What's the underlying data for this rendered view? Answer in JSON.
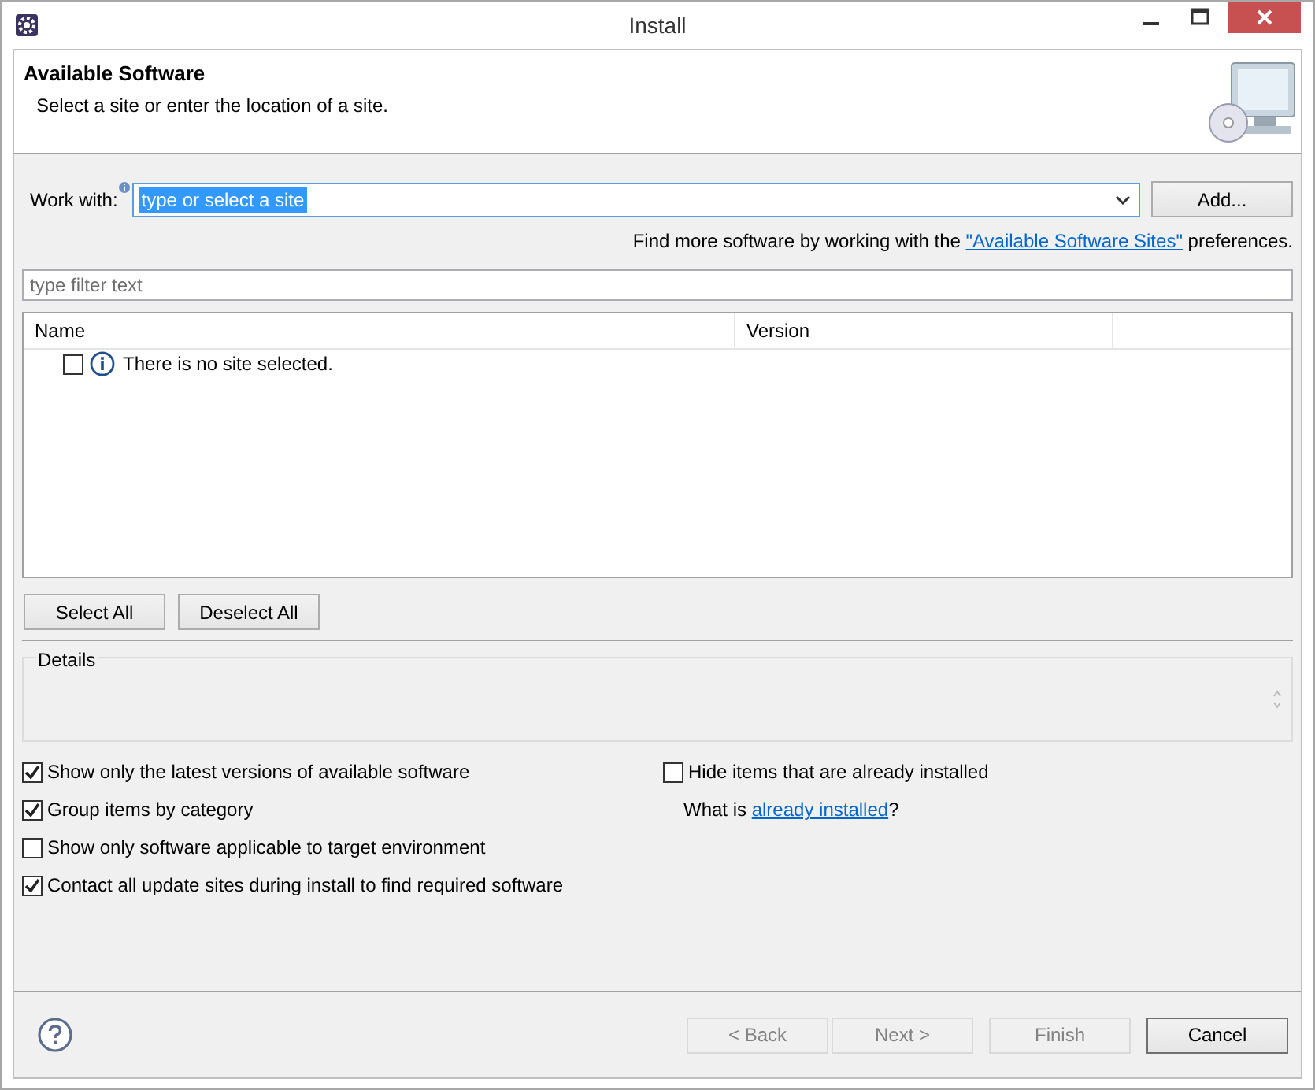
{
  "window": {
    "title": "Install"
  },
  "header": {
    "title": "Available Software",
    "description": "Select a site or enter the location of a site."
  },
  "work_with": {
    "label": "Work with:",
    "value": "type or select a site",
    "text_selected": true,
    "button": "Add..."
  },
  "find_more": {
    "before": "Find more software by working with the ",
    "link": "\"Available Software Sites\"",
    "after": " preferences."
  },
  "filter": {
    "placeholder": "type filter text"
  },
  "table": {
    "columns": [
      "Name",
      "Version"
    ],
    "rows": [
      {
        "checked": false,
        "text": "There is no site selected."
      }
    ]
  },
  "selection_buttons": [
    "Select All",
    "Deselect All"
  ],
  "details": {
    "label": "Details"
  },
  "options_left": [
    {
      "label": "Show only the latest versions of available software",
      "checked": true
    },
    {
      "label": "Group items by category",
      "checked": true
    },
    {
      "label": "Show only software applicable to target environment",
      "checked": false
    },
    {
      "label": "Contact all update sites during install to find required software",
      "checked": true
    }
  ],
  "options_right": [
    {
      "label": "Hide items that are already installed",
      "checked": false
    }
  ],
  "installed_note": {
    "before": "What is ",
    "link": "already installed",
    "after": "?"
  },
  "footer_buttons": [
    {
      "label": "< Back",
      "disabled": true
    },
    {
      "label": "Next >",
      "disabled": true
    },
    {
      "label": "Finish",
      "disabled": true
    },
    {
      "label": "Cancel",
      "disabled": false
    }
  ]
}
